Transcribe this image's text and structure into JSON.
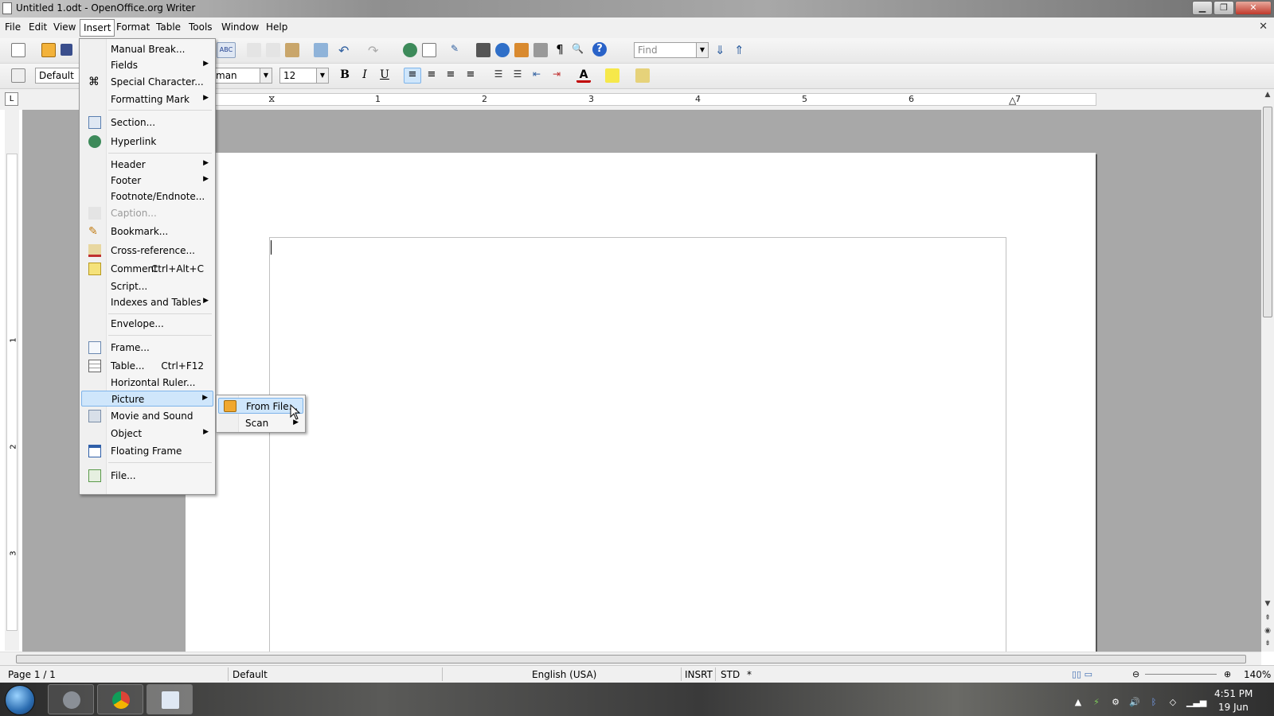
{
  "window": {
    "title": "Untitled 1.odt - OpenOffice.org Writer"
  },
  "menubar": {
    "items": [
      {
        "label": "File"
      },
      {
        "label": "Edit"
      },
      {
        "label": "View"
      },
      {
        "label": "Insert"
      },
      {
        "label": "Format"
      },
      {
        "label": "Table"
      },
      {
        "label": "Tools"
      },
      {
        "label": "Window"
      },
      {
        "label": "Help"
      }
    ]
  },
  "toolbar": {
    "find_placeholder": "Find",
    "paragraph_style": "Default",
    "font_name_partial": "man",
    "font_size": "12"
  },
  "ruler": {
    "h_numbers": [
      "1",
      "2",
      "3",
      "4",
      "5",
      "6",
      "7"
    ],
    "v_numbers": [
      "1",
      "2",
      "3"
    ]
  },
  "insert_menu": {
    "items": [
      {
        "label": "Manual Break...",
        "icon": null
      },
      {
        "label": "Fields",
        "submenu": true
      },
      {
        "label": "Special Character...",
        "icon": "special-character-icon"
      },
      {
        "label": "Formatting Mark",
        "submenu": true
      },
      {
        "label": "Section...",
        "icon": "section-icon"
      },
      {
        "label": "Hyperlink",
        "icon": "hyperlink-icon"
      },
      {
        "label": "Header",
        "submenu": true
      },
      {
        "label": "Footer",
        "submenu": true
      },
      {
        "label": "Footnote/Endnote..."
      },
      {
        "label": "Caption...",
        "disabled": true,
        "icon": "caption-icon"
      },
      {
        "label": "Bookmark...",
        "icon": "bookmark-icon"
      },
      {
        "label": "Cross-reference...",
        "icon": "cross-reference-icon"
      },
      {
        "label": "Comment",
        "shortcut": "Ctrl+Alt+C",
        "icon": "comment-icon"
      },
      {
        "label": "Script..."
      },
      {
        "label": "Indexes and Tables",
        "submenu": true
      },
      {
        "label": "Envelope..."
      },
      {
        "label": "Frame...",
        "icon": "frame-icon"
      },
      {
        "label": "Table...",
        "shortcut": "Ctrl+F12",
        "icon": "table-icon"
      },
      {
        "label": "Horizontal Ruler..."
      },
      {
        "label": "Picture",
        "submenu": true,
        "highlighted": true
      },
      {
        "label": "Movie and Sound",
        "icon": "movie-sound-icon"
      },
      {
        "label": "Object",
        "submenu": true
      },
      {
        "label": "Floating Frame",
        "icon": "floating-frame-icon"
      },
      {
        "label": "File...",
        "icon": "file-icon"
      }
    ]
  },
  "picture_submenu": {
    "items": [
      {
        "label": "From File...",
        "highlighted": true,
        "icon": "picture-from-file-icon"
      },
      {
        "label": "Scan",
        "submenu": true
      }
    ]
  },
  "statusbar": {
    "page": "Page 1 / 1",
    "style": "Default",
    "language": "English (USA)",
    "insert_mode": "INSRT",
    "selection_mode": "STD",
    "modified": "*",
    "zoom": "140%"
  },
  "taskbar": {
    "time": "4:51 PM",
    "date": "19 Jun"
  },
  "colors": {
    "menu_highlight": "#cfe6fb",
    "workspace": "#a8a8a8"
  }
}
